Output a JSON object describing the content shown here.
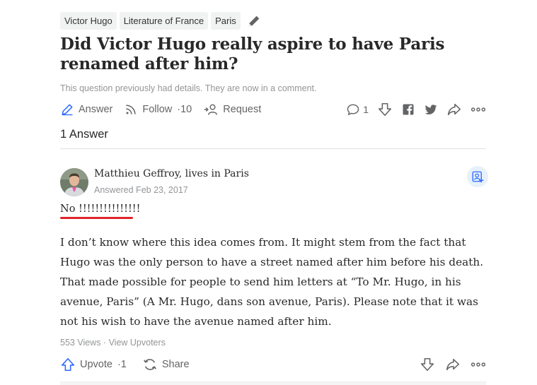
{
  "topics": [
    "Victor Hugo",
    "Literature of France",
    "Paris"
  ],
  "question": {
    "title": "Did Victor Hugo really aspire to have Paris renamed after him?",
    "note": "This question previously had details. They are now in a comment."
  },
  "actions": {
    "answer_label": "Answer",
    "follow_label": "Follow",
    "follow_count": "10",
    "request_label": "Request",
    "comment_count": "1"
  },
  "answer_count": "1 Answer",
  "answer": {
    "author": "Matthieu Geffroy, lives in Paris",
    "answered": "Answered Feb 23, 2017",
    "headline": "No !!!!!!!!!!!!!!!",
    "body": "I don’t know where this idea comes from. It might stem from the fact that Hugo was the only person to have a street named after him before his death. That made possible for people to send him letters at “To Mr. Hugo, in his avenue, Paris” (A Mr. Hugo, dans son avenue, Paris). Please note that it was not his wish to have the avenue named after him.",
    "views": "553 Views",
    "separator": " · ",
    "view_upvoters": "View Upvoters",
    "upvote_label": "Upvote",
    "upvote_count": "1",
    "share_label": "Share"
  },
  "colors": {
    "accent": "#2e69ff",
    "muted": "#636466",
    "underline": "#e0232a",
    "follow_bg": "#e6f1fb"
  }
}
